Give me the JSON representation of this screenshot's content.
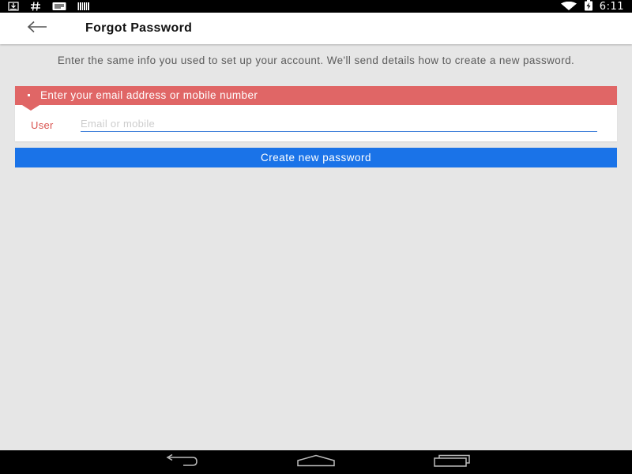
{
  "status_bar": {
    "time": "6:11",
    "left_icons": [
      "download-icon",
      "hash-icon",
      "message-icon",
      "barcode-icon"
    ],
    "right_icons": [
      "wifi-icon",
      "battery-charging-icon"
    ]
  },
  "app_bar": {
    "back_icon": "arrow-left-icon",
    "title": "Forgot Password"
  },
  "instructions": "Enter the same info you used to set up your account. We'll send details how to create a new password.",
  "form": {
    "error_message": "Enter your email address or mobile number",
    "field_label": "User",
    "input_value": "",
    "input_placeholder": "Email or mobile"
  },
  "primary_button": {
    "label": "Create new password"
  },
  "nav_bar": {
    "icons": [
      "nav-back-icon",
      "nav-home-icon",
      "nav-recents-icon"
    ]
  },
  "colors": {
    "status_bar": "#000000",
    "app_bar": "#ffffff",
    "background": "#e6e6e6",
    "error_banner": "#e06666",
    "label_red": "#d9534f",
    "primary_blue": "#1a73e8",
    "input_underline": "#3f7fd9"
  }
}
